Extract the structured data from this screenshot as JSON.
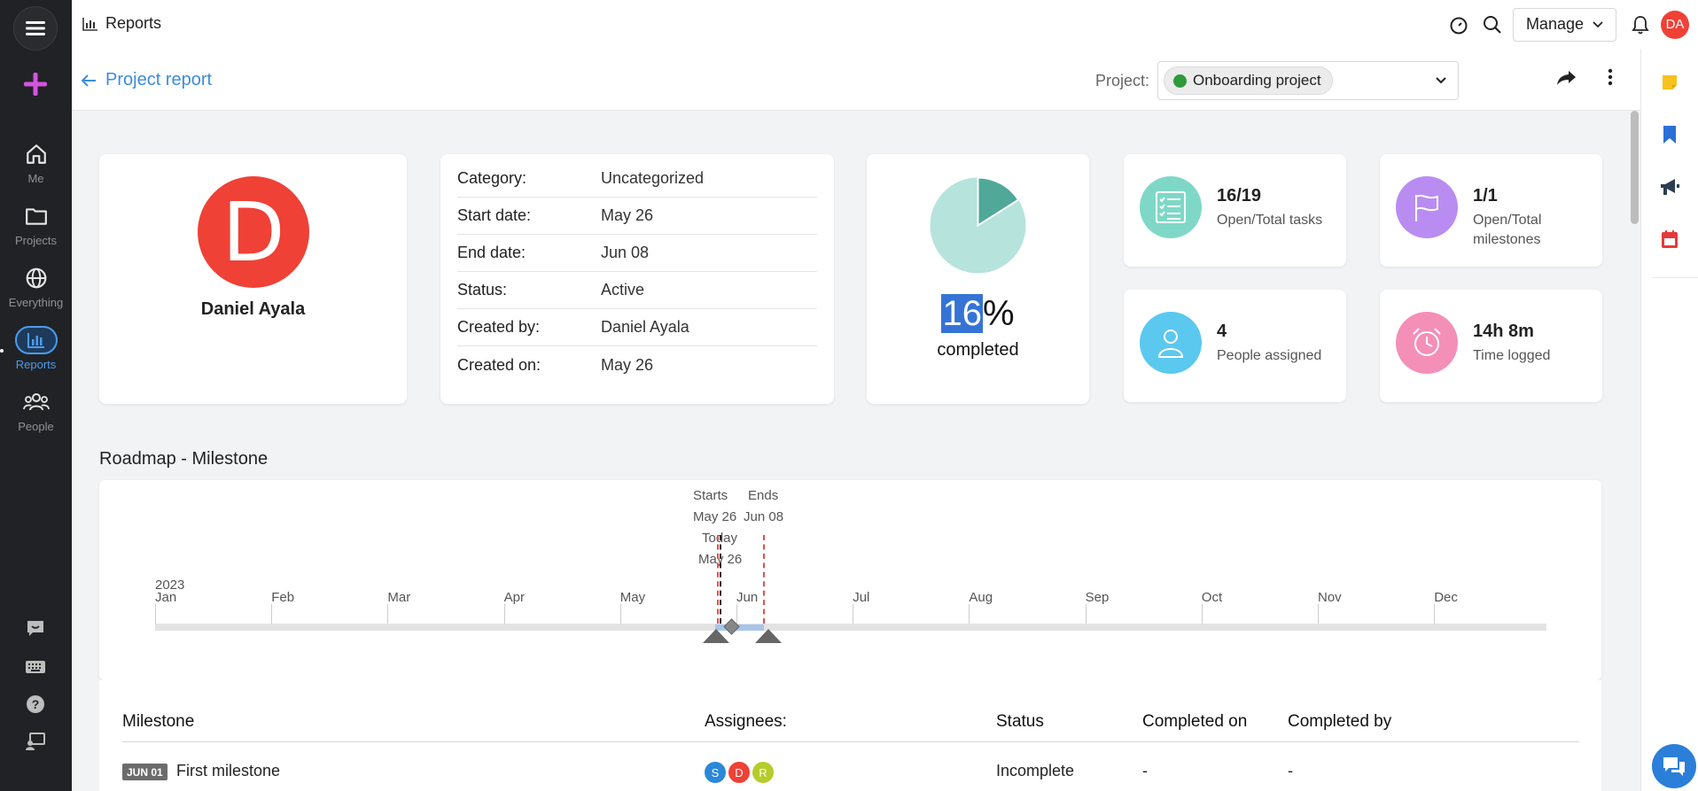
{
  "topbar": {
    "title": "Reports",
    "manage_label": "Manage",
    "user_initials": "DA"
  },
  "sidebar": {
    "items": [
      {
        "label": "Me",
        "icon": "home-icon"
      },
      {
        "label": "Projects",
        "icon": "folder-icon"
      },
      {
        "label": "Everything",
        "icon": "globe-icon"
      },
      {
        "label": "Reports",
        "icon": "bar-chart-icon",
        "active": true
      },
      {
        "label": "People",
        "icon": "people-icon"
      }
    ]
  },
  "subheader": {
    "back_label": "Project report",
    "project_label": "Project:",
    "project_name": "Onboarding project",
    "project_color": "#2e9a3a"
  },
  "owner": {
    "initial": "D",
    "name": "Daniel Ayala",
    "color": "#ef4136"
  },
  "details": [
    {
      "label": "Category:",
      "value": "Uncategorized"
    },
    {
      "label": "Start date:",
      "value": "May 26"
    },
    {
      "label": "End date:",
      "value": "Jun 08"
    },
    {
      "label": "Status:",
      "value": "Active"
    },
    {
      "label": "Created by:",
      "value": "Daniel Ayala"
    },
    {
      "label": "Created on:",
      "value": "May 26"
    }
  ],
  "progress": {
    "percent": "16",
    "percent_sign": "%",
    "label": "completed",
    "fraction": 0.16
  },
  "stats": [
    {
      "value": "16/19",
      "label": "Open/Total tasks",
      "icon": "checklist-icon",
      "color": "#7fd8c7"
    },
    {
      "value": "1/1",
      "label": "Open/Total milestones",
      "icon": "flag-icon",
      "color": "#b98cf2"
    },
    {
      "value": "4",
      "label": "People assigned",
      "icon": "person-icon",
      "color": "#5bc8ef"
    },
    {
      "value": "14h 8m",
      "label": "Time logged",
      "icon": "alarm-clock-icon",
      "color": "#f48fb8"
    }
  ],
  "roadmap": {
    "title": "Roadmap - Milestone",
    "year": "2023",
    "months": [
      "Jan",
      "Feb",
      "Mar",
      "Apr",
      "May",
      "Jun",
      "Jul",
      "Aug",
      "Sep",
      "Oct",
      "Nov",
      "Dec"
    ],
    "starts_label": "Starts",
    "starts_date": "May 26",
    "ends_label": "Ends",
    "ends_date": "Jun 08",
    "today_label": "Today",
    "today_date": "May 26"
  },
  "table": {
    "headers": {
      "milestone": "Milestone",
      "assignees": "Assignees:",
      "status": "Status",
      "completed_on": "Completed on",
      "completed_by": "Completed by"
    },
    "rows": [
      {
        "date_badge": "JUN 01",
        "name": "First milestone",
        "assignees": [
          {
            "initial": "S",
            "color": "#2b88d8"
          },
          {
            "initial": "D",
            "color": "#ef4136"
          },
          {
            "initial": "R",
            "color": "#b5cc2b"
          }
        ],
        "status": "Incomplete",
        "completed_on": "-",
        "completed_by": "-"
      }
    ]
  }
}
